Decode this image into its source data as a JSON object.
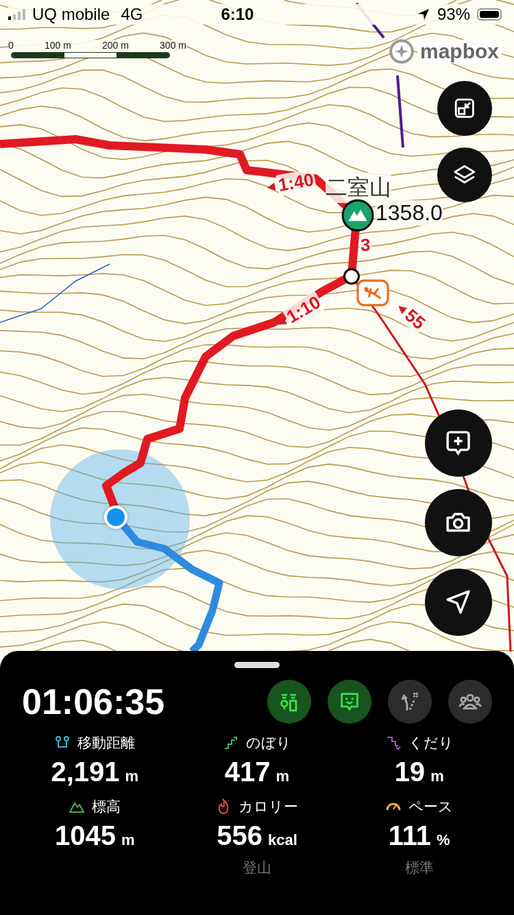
{
  "status_bar": {
    "carrier": "UQ mobile",
    "network": "4G",
    "time": "6:10",
    "battery": "93%"
  },
  "scale_bar": {
    "labels": [
      "0",
      "100 m",
      "200 m",
      "300 m"
    ]
  },
  "map": {
    "attribution": "mapbox",
    "peak": {
      "name": "二室山",
      "elevation": "1358.0"
    },
    "route_labels": [
      {
        "text": "1:40",
        "arrow": true
      },
      {
        "text": "3",
        "arrow": false
      },
      {
        "text": "1:10",
        "arrow": true
      },
      {
        "text": "55",
        "arrow": true
      }
    ]
  },
  "map_buttons": [
    {
      "kind": "expand"
    },
    {
      "kind": "layers"
    },
    {
      "kind": "add-note"
    },
    {
      "kind": "camera"
    },
    {
      "kind": "navigate"
    }
  ],
  "panel": {
    "timer": "01:06:35",
    "toggles": [
      {
        "kind": "signal",
        "on": true
      },
      {
        "kind": "chat",
        "on": true
      },
      {
        "kind": "off-route",
        "on": false
      },
      {
        "kind": "group",
        "on": false
      }
    ],
    "stats": [
      {
        "kind": "distance",
        "label": "移動距離",
        "value": "2,191",
        "unit": "m"
      },
      {
        "kind": "ascent",
        "label": "のぼり",
        "value": "417",
        "unit": "m"
      },
      {
        "kind": "descent",
        "label": "くだり",
        "value": "19",
        "unit": "m"
      },
      {
        "kind": "elevation",
        "label": "標高",
        "value": "1045",
        "unit": "m"
      },
      {
        "kind": "calories",
        "label": "カロリー",
        "value": "556",
        "unit": "kcal",
        "note": "登山"
      },
      {
        "kind": "pace",
        "label": "ペース",
        "value": "111",
        "unit": "%",
        "note": "標準"
      }
    ]
  }
}
